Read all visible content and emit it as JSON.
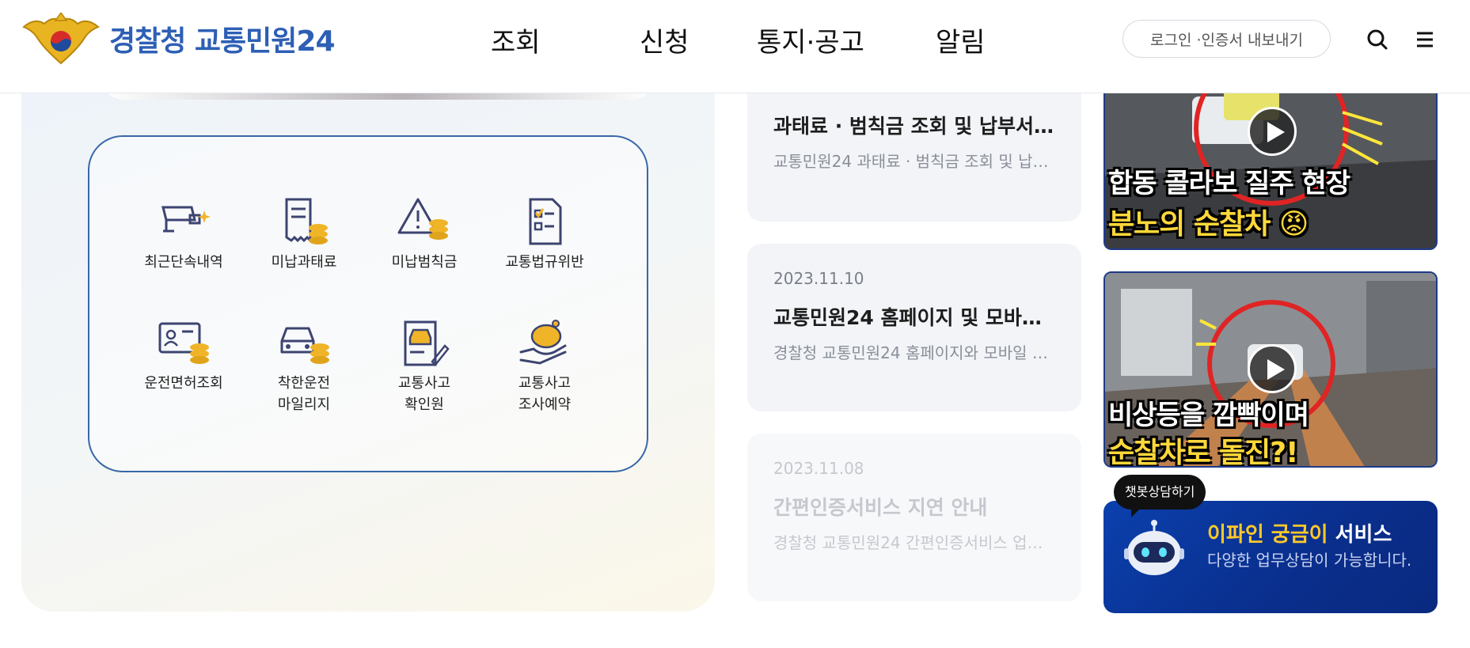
{
  "header": {
    "logo": {
      "org": "경찰청",
      "service": "교통민원24"
    },
    "nav": [
      "조회",
      "신청",
      "통지·공고",
      "알림"
    ],
    "login_label": "로그인 ·인증서 내보내기"
  },
  "services": [
    {
      "label": "최근단속내역",
      "icon": "camera-icon"
    },
    {
      "label": "미납과태료",
      "icon": "receipt-coins-icon"
    },
    {
      "label": "미납범칙금",
      "icon": "warning-coins-icon"
    },
    {
      "label": "교통법규위반",
      "icon": "checklist-icon"
    },
    {
      "label": "운전면허조회",
      "icon": "id-card-coins-icon"
    },
    {
      "label": "착한운전\n마일리지",
      "icon": "car-coins-icon"
    },
    {
      "label": "교통사고\n확인원",
      "icon": "car-document-icon"
    },
    {
      "label": "교통사고\n조사예약",
      "icon": "piggy-hand-icon"
    }
  ],
  "notices": [
    {
      "date": "",
      "title": "과태료 · 범칙금 조회 및 납부서…",
      "desc": "교통민원24 과태료 · 범칙금 조회 및 납…"
    },
    {
      "date": "2023.11.10",
      "title": "교통민원24 홈페이지 및 모바…",
      "desc": "경찰청 교통민원24 홈페이지와 모바일 …"
    },
    {
      "date": "2023.11.08",
      "title": "간편인증서비스 지연 안내",
      "desc": "경찰청 교통민원24 간편인증서비스 업…"
    }
  ],
  "videos": [
    {
      "line1": "합동 콜라보 질주 현장",
      "line2": "분노의 순찰차 😡"
    },
    {
      "line1": "비상등을 깜빡이며",
      "line2": "순찰차로 돌진?!"
    }
  ],
  "chatbot": {
    "bubble": "챗봇상담하기",
    "title_highlight": "이파인 궁금이",
    "title_rest": " 서비스",
    "desc": "다양한 업무상담이 가능합니다."
  },
  "colors": {
    "brand_blue": "#1f4b9c",
    "frame_blue": "#3768a8",
    "chatbot_bg": "#0b40ad",
    "highlight": "#ffc928"
  }
}
